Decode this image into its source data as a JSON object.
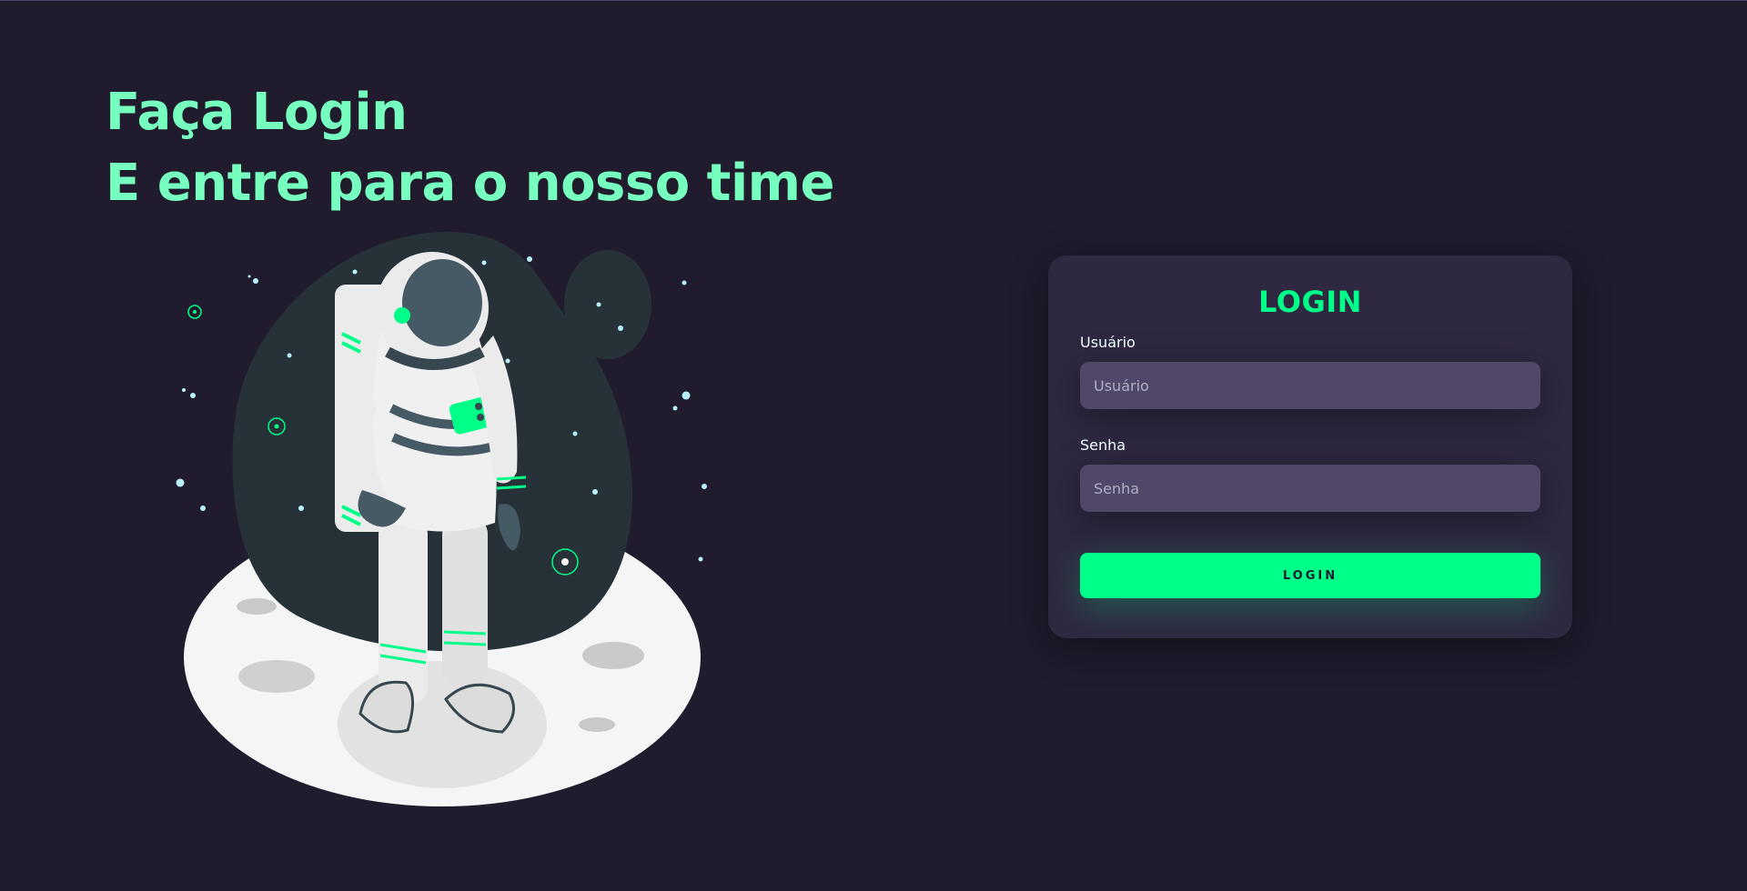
{
  "hero": {
    "line1": "Faça Login",
    "line2": "E entre para o nosso time"
  },
  "illustration": {
    "icon": "astronaut-on-moon-illustration"
  },
  "login": {
    "title": "LOGIN",
    "username_label": "Usuário",
    "username_placeholder": "Usuário",
    "username_value": "",
    "password_label": "Senha",
    "password_placeholder": "Senha",
    "password_value": "",
    "button_label": "LOGIN"
  },
  "colors": {
    "background": "#201b2d",
    "accent": "#00ff88",
    "headline": "#77ffc0",
    "card": "#2f2841",
    "input": "#514869"
  }
}
